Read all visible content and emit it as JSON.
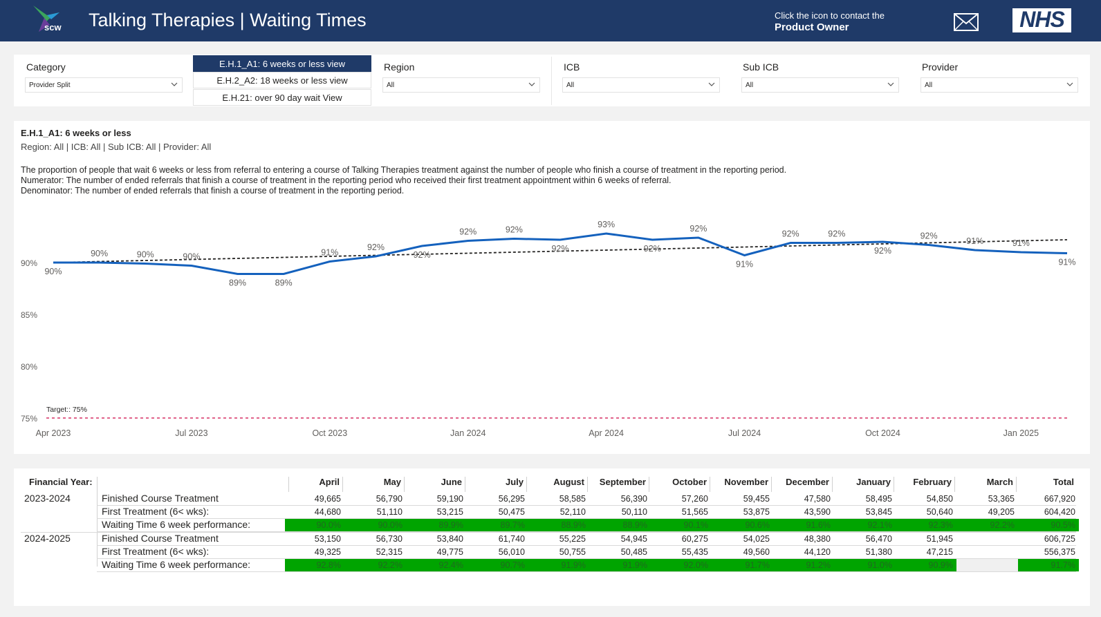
{
  "header": {
    "logo_text": "scw",
    "title": "Talking Therapies | Waiting Times",
    "contact_line1": "Click the icon to contact the",
    "contact_line2": "Product Owner",
    "nhs_logo": "NHS"
  },
  "filters": {
    "category_label": "Category",
    "category_value": "Provider Split",
    "views": [
      "E.H.1_A1: 6 weeks or less view",
      "E.H.2_A2: 18 weeks or less view",
      "E.H.21: over 90 day wait View"
    ],
    "region_label": "Region",
    "region_value": "All",
    "icb_label": "ICB",
    "icb_value": "All",
    "subicb_label": "Sub ICB",
    "subicb_value": "All",
    "provider_label": "Provider",
    "provider_value": "All"
  },
  "chart_panel": {
    "title": "E.H.1_A1: 6 weeks or less",
    "subtitle": "Region: All | ICB: All | Sub ICB: All | Provider: All",
    "desc1": "The proportion of people that wait 6 weeks or less from referral to entering a course of Talking Therapies treatment against the number of people who finish a course of treatment in the reporting period.",
    "desc2": "Numerator: The number of ended referrals that finish a course of treatment in the reporting period who received their first treatment appointment within 6 weeks of referral.",
    "desc3": "Denominator: The number of ended referrals that finish a course of treatment in the reporting period."
  },
  "chart_data": {
    "type": "line",
    "x_tick_labels": [
      "Apr 2023",
      "Jul 2023",
      "Oct 2023",
      "Jan 2024",
      "Apr 2024",
      "Jul 2024",
      "Oct 2024",
      "Jan 2025"
    ],
    "y_tick_labels": [
      "90%",
      "85%",
      "80%",
      "75%"
    ],
    "ylim": [
      75,
      92.5
    ],
    "series": [
      {
        "values": [
          90.0,
          90.0,
          89.9,
          89.7,
          88.9,
          88.9,
          90.1,
          90.6,
          91.6,
          92.1,
          92.3,
          92.2,
          92.8,
          92.2,
          92.4,
          90.7,
          91.9,
          91.9,
          92.0,
          91.7,
          91.2,
          91.0,
          90.9
        ],
        "data_labels": [
          "90%",
          "90%",
          "90%",
          "90%",
          "89%",
          "89%",
          "91%",
          "92%",
          "92%",
          "92%",
          "92%",
          "92%",
          "93%",
          "92%",
          "92%",
          "91%",
          "92%",
          "92%",
          "92%",
          "92%",
          "91%",
          "91%",
          "91%"
        ],
        "color": "#1461bd"
      }
    ],
    "trend": {
      "start": 90.0,
      "end": 92.2,
      "color": "#252423",
      "style": "dashed"
    },
    "target": {
      "label": "Target:: 75%",
      "value": 75,
      "color": "#e0638a"
    }
  },
  "table": {
    "fy_header": "Financial Year:",
    "months": [
      "April",
      "May",
      "June",
      "July",
      "August",
      "September",
      "October",
      "November",
      "December",
      "January",
      "February",
      "March",
      "Total"
    ],
    "row_labels": [
      "Finished Course Treatment",
      "First Treatment (6< wks):",
      "Waiting Time 6 week performance:"
    ],
    "years": [
      {
        "label": "2023-2024",
        "finished": [
          "49,665",
          "56,790",
          "59,190",
          "56,295",
          "58,585",
          "56,390",
          "57,260",
          "59,455",
          "47,580",
          "58,495",
          "54,850",
          "53,365",
          "667,920"
        ],
        "first": [
          "44,680",
          "51,110",
          "53,215",
          "50,475",
          "52,110",
          "50,110",
          "51,565",
          "53,875",
          "43,590",
          "53,845",
          "50,640",
          "49,205",
          "604,420"
        ],
        "perf": [
          "90.0%",
          "90.0%",
          "89.9%",
          "89.7%",
          "88.9%",
          "88.9%",
          "90.1%",
          "90.6%",
          "91.6%",
          "92.1%",
          "92.3%",
          "92.2%",
          "90.5%"
        ]
      },
      {
        "label": "2024-2025",
        "finished": [
          "53,150",
          "56,730",
          "53,840",
          "61,740",
          "55,225",
          "54,945",
          "60,275",
          "54,025",
          "48,380",
          "56,470",
          "51,945",
          "",
          "606,725"
        ],
        "first": [
          "49,325",
          "52,315",
          "49,775",
          "56,010",
          "50,755",
          "50,485",
          "55,435",
          "49,560",
          "44,120",
          "51,380",
          "47,215",
          "",
          "556,375"
        ],
        "perf": [
          "92.8%",
          "92.2%",
          "92.4%",
          "90.7%",
          "91.9%",
          "91.9%",
          "92.0%",
          "91.7%",
          "91.2%",
          "91.0%",
          "90.9%",
          "",
          "91.7%"
        ]
      }
    ]
  }
}
